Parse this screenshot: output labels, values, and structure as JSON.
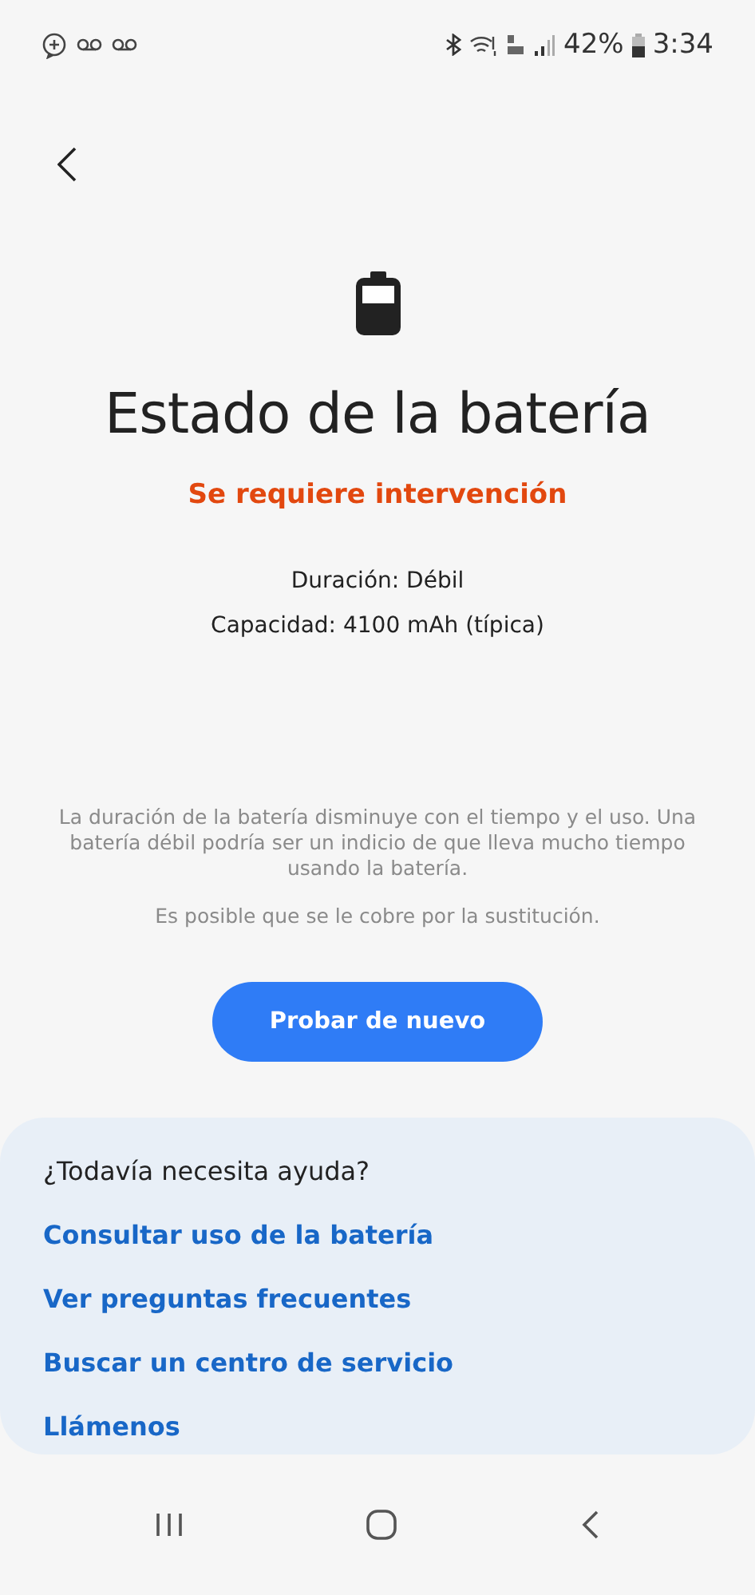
{
  "status_bar": {
    "battery_percent": "42%",
    "time": "3:34"
  },
  "title": "Estado de la batería",
  "status": "Se requiere intervención",
  "details": [
    "Duración: Débil",
    "Capacidad: 4100 mAh (típica)"
  ],
  "notes": [
    "La duración de la batería disminuye con el tiempo y el uso. Una batería débil podría ser un indicio de que lleva mucho tiempo usando la batería.",
    "Es posible que se le cobre por la sustitución."
  ],
  "retry_button": "Probar de nuevo",
  "help": {
    "title": "¿Todavía necesita ayuda?",
    "links": [
      "Consultar uso de la batería",
      "Ver preguntas frecuentes",
      "Buscar un centro de servicio",
      "Llámenos"
    ]
  }
}
